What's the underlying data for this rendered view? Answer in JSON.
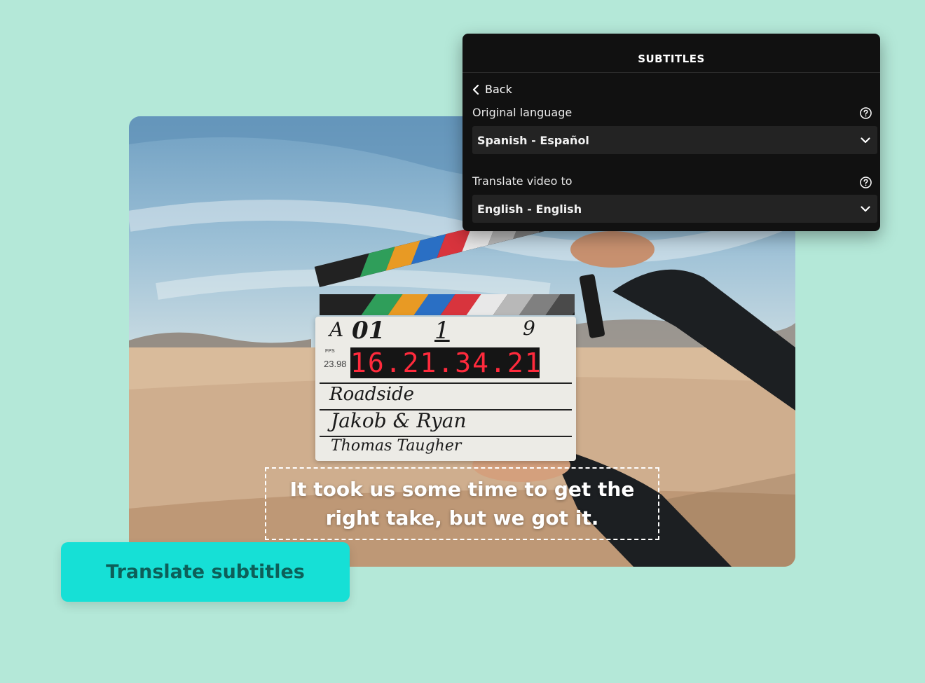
{
  "panel": {
    "title": "SUBTITLES",
    "back_label": "Back",
    "original_language": {
      "label": "Original language",
      "selected": "Spanish - Español"
    },
    "translate_to": {
      "label": "Translate video to",
      "selected": "English - English"
    }
  },
  "video": {
    "subtitle_text": "It took us some time to get the right take, but we got it.",
    "slate": {
      "roll": "A",
      "scene_number": "01",
      "scene": "1",
      "take": "9",
      "fps": "23.98",
      "timecode": "16.21.34.21",
      "production": "Roadside",
      "director": "Jakob & Ryan",
      "camera": "Thomas Taugher"
    }
  },
  "cta": {
    "label": "Translate subtitles"
  },
  "colors": {
    "background": "#b4e8d8",
    "panel": "#111111",
    "select": "#232323",
    "cta": "#16e0d6",
    "cta_text": "#0d5f59"
  },
  "icons": [
    "chevron-left-icon",
    "help-circle-icon",
    "chevron-down-icon"
  ]
}
